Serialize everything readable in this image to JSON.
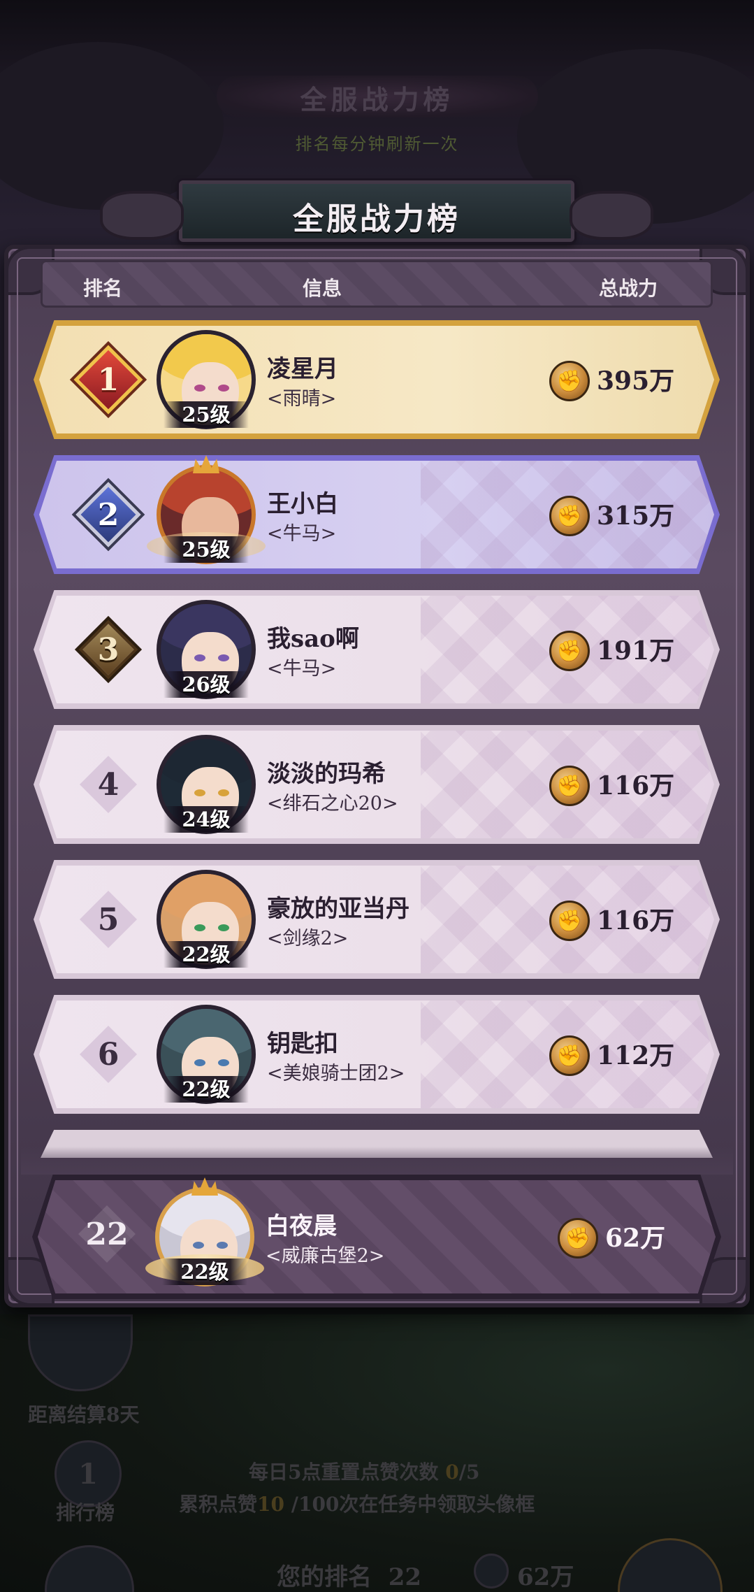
{
  "background": {
    "title": "全服战力榜",
    "subtitle": "排名每分钟刷新一次",
    "countdown": "距离结算8天",
    "leaderboard_label": "排行榜",
    "leaderboard_rank_icon_number": "1",
    "daily_reset_prefix": "每日5点重置点赞次数 ",
    "daily_used": "0",
    "daily_total": "/5",
    "accum_prefix": "累积点赞",
    "accum_count": "10",
    "accum_suffix": " /100次在任务中领取头像框",
    "my_rank_label": "您的排名",
    "my_rank_value": "22",
    "my_power": "62万"
  },
  "panel": {
    "title": "全服战力榜",
    "headers": {
      "rank": "排名",
      "info": "信息",
      "power": "总战力"
    }
  },
  "rows": [
    {
      "rank": "1",
      "level": "25级",
      "name": "凌星月",
      "guild": "<雨晴>",
      "power": "395万",
      "style": "gold"
    },
    {
      "rank": "2",
      "level": "25级",
      "name": "王小白",
      "guild": "<牛马>",
      "power": "315万",
      "style": "silver"
    },
    {
      "rank": "3",
      "level": "26级",
      "name": "我sao啊",
      "guild": "<牛马>",
      "power": "191万",
      "style": "bronze"
    },
    {
      "rank": "4",
      "level": "24级",
      "name": "淡淡的玛希",
      "guild": "<绯石之心20>",
      "power": "116万",
      "style": "plain"
    },
    {
      "rank": "5",
      "level": "22级",
      "name": "豪放的亚当丹",
      "guild": "<剑缘2>",
      "power": "116万",
      "style": "plain"
    },
    {
      "rank": "6",
      "level": "22级",
      "name": "钥匙扣",
      "guild": "<美娘骑士团2>",
      "power": "112万",
      "style": "plain"
    }
  ],
  "me": {
    "rank": "22",
    "level": "22级",
    "name": "白夜晨",
    "guild": "<威廉古堡2>",
    "power": "62万"
  },
  "colors": {
    "gold_row": "#f3dfb2",
    "silver_row": "#cdc4ec",
    "normal_row": "#ece0ea",
    "me_row": "#5a4660"
  },
  "icons": {
    "power": "fist-flame-icon"
  }
}
